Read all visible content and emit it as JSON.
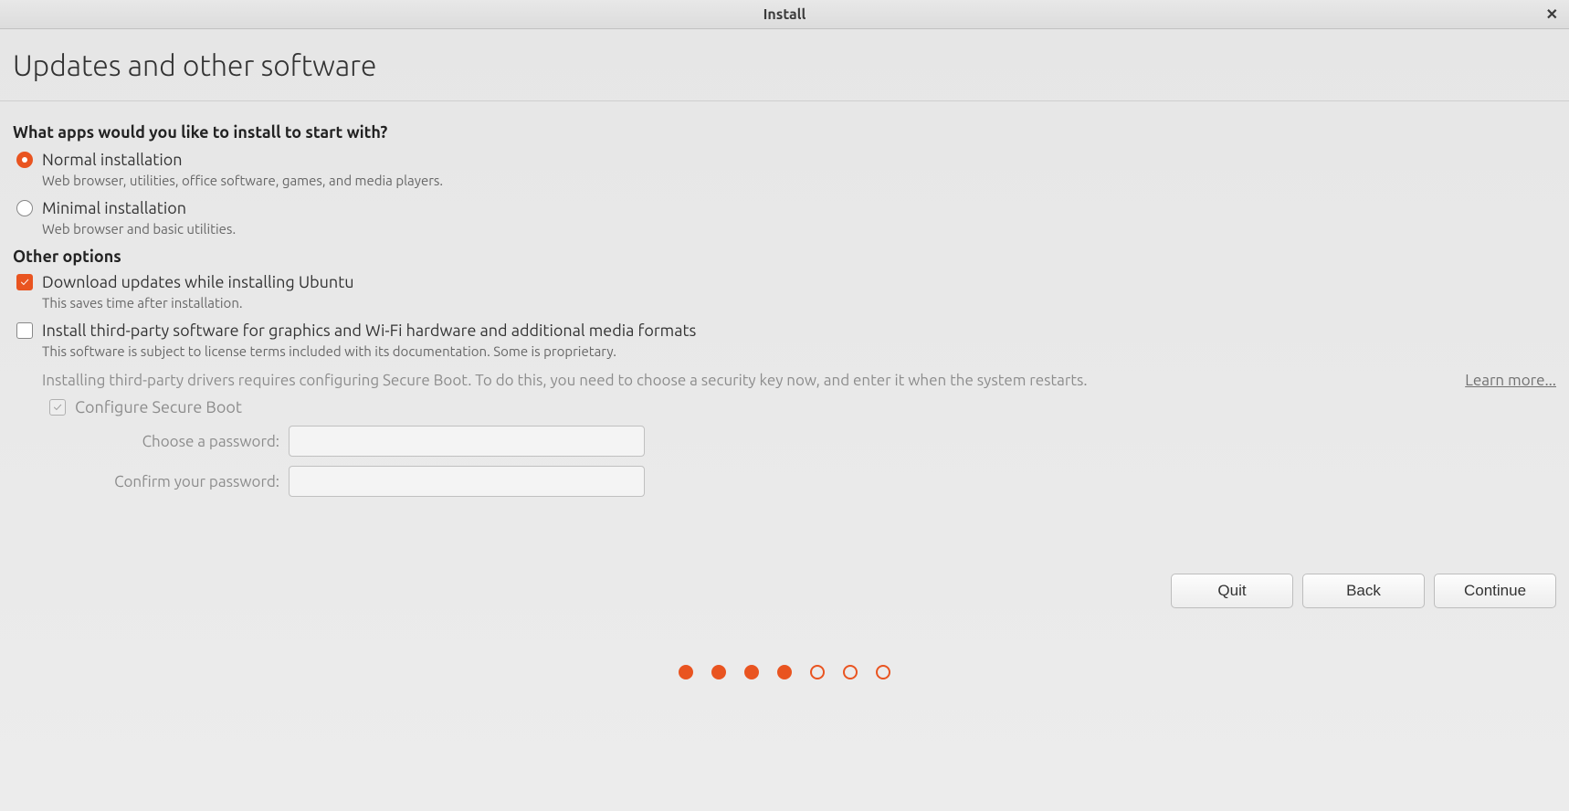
{
  "titlebar": {
    "title": "Install"
  },
  "header": {
    "title": "Updates and other software"
  },
  "section1": {
    "question": "What apps would you like to install to start with?",
    "options": [
      {
        "label": "Normal installation",
        "desc": "Web browser, utilities, office software, games, and media players.",
        "selected": true
      },
      {
        "label": "Minimal installation",
        "desc": "Web browser and basic utilities.",
        "selected": false
      }
    ]
  },
  "section2": {
    "header": "Other options",
    "checks": [
      {
        "label": "Download updates while installing Ubuntu",
        "desc": "This saves time after installation.",
        "selected": true
      },
      {
        "label": "Install third-party software for graphics and Wi-Fi hardware and additional media formats",
        "desc": "This software is subject to license terms included with its documentation. Some is proprietary.",
        "selected": false
      }
    ]
  },
  "secureboot": {
    "note": "Installing third-party drivers requires configuring Secure Boot. To do this, you need to choose a security key now, and enter it when the system restarts.",
    "learn_more": "Learn more...",
    "configure_label": "Configure Secure Boot",
    "configure_selected": true,
    "choose_pw_label": "Choose a password:",
    "confirm_pw_label": "Confirm your password:",
    "choose_pw_value": "",
    "confirm_pw_value": ""
  },
  "buttons": {
    "quit": "Quit",
    "back": "Back",
    "continue": "Continue"
  },
  "progress": {
    "total": 7,
    "filled": 4
  }
}
